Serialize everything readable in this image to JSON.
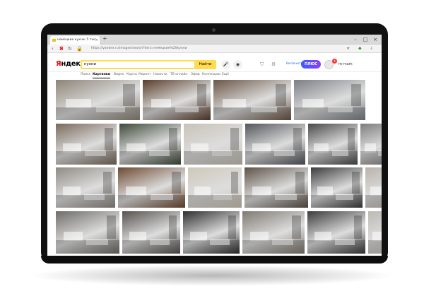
{
  "browser": {
    "tab_title": "немецкие кухни: 5 тыс",
    "tab_close": "×",
    "new_tab": "+",
    "url": "https://yandex.ru/images/search?text=немецкие%20кухни",
    "window_controls": [
      "–",
      "□",
      "×"
    ]
  },
  "header": {
    "logo": "Яндекс",
    "search_value": "кухни",
    "search_button": "Найти",
    "enable_label": "Включить",
    "plus_label": "ПЛЮС",
    "notification_count": "4",
    "username": "re-mark"
  },
  "services": [
    {
      "label": "Поиск",
      "active": false
    },
    {
      "label": "Картинки",
      "active": true
    },
    {
      "label": "Видео",
      "active": false
    },
    {
      "label": "Карты",
      "active": false
    },
    {
      "label": "Маркет",
      "active": false
    },
    {
      "label": "Новости",
      "active": false
    },
    {
      "label": "ТВ онлайн",
      "active": false
    },
    {
      "label": "Эфир",
      "active": false
    },
    {
      "label": "Коллекции",
      "active": false
    },
    {
      "label": "Ещё",
      "active": false
    }
  ],
  "icons": {
    "back": "chevron-left-icon",
    "forward": "chevron-right-icon",
    "reload": "reload-icon",
    "mic": "microphone-icon",
    "camera": "camera-icon"
  },
  "colors": {
    "accent_yellow": "#ffdb4d",
    "plus_start": "#3d5afe",
    "plus_end": "#8a3ffc",
    "logo_red": "#ff0000"
  },
  "results": {
    "rows": [
      {
        "tiles": [
          {
            "c": "#8d8477"
          },
          {
            "c": "#5a3d2b"
          },
          {
            "c": "#6b5646"
          },
          {
            "c": "#7b7f86"
          }
        ]
      },
      {
        "tiles": [
          {
            "c": "#7a6b5c"
          },
          {
            "c": "#3f4a3a"
          },
          {
            "c": "#c9c3b8"
          },
          {
            "c": "#55575c"
          },
          {
            "c": "#4a4a4a"
          },
          {
            "c": "#7d7d80"
          }
        ]
      },
      {
        "tiles": [
          {
            "c": "#8f8a83"
          },
          {
            "c": "#6e4a32"
          },
          {
            "c": "#cfc8b9"
          },
          {
            "c": "#5d5247"
          },
          {
            "c": "#3b3b3d"
          },
          {
            "c": "#b9b3aa"
          }
        ]
      },
      {
        "tiles": [
          {
            "c": "#6f6c68"
          },
          {
            "c": "#56524f"
          },
          {
            "c": "#2f2f31"
          },
          {
            "c": "#7f7a73"
          },
          {
            "c": "#3c3c3e"
          },
          {
            "c": "#bdbab4"
          }
        ]
      }
    ]
  }
}
